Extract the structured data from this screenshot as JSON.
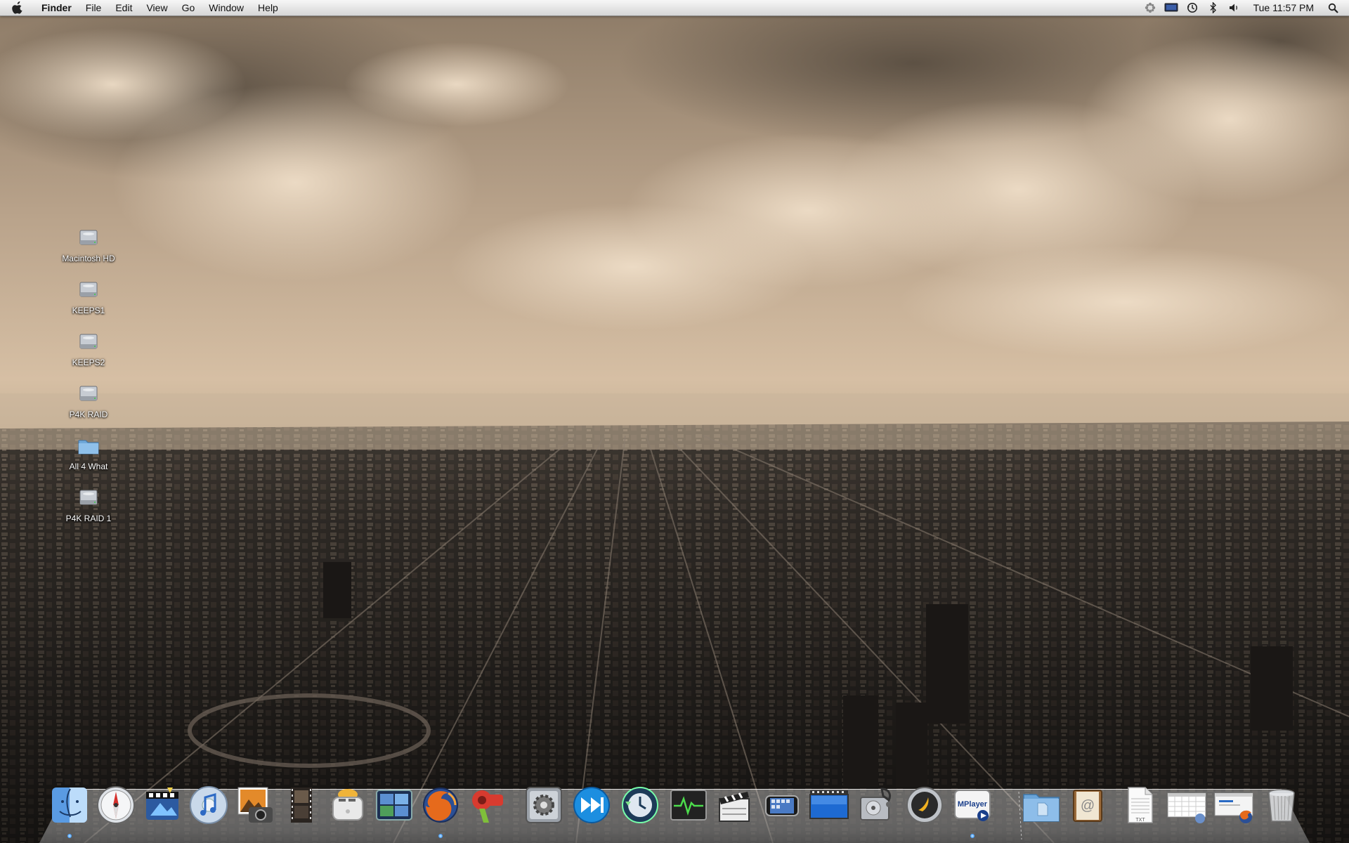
{
  "menubar": {
    "app_name": "Finder",
    "menus": [
      "File",
      "Edit",
      "View",
      "Go",
      "Window",
      "Help"
    ],
    "status_icons": [
      "flower-icon",
      "display-icon",
      "time-machine-icon",
      "bluetooth-icon",
      "volume-icon"
    ],
    "clock": "Tue 11:57 PM",
    "spotlight_icon": "magnifier-icon"
  },
  "desktop": {
    "icons": [
      {
        "label": "Macintosh HD",
        "kind": "drive"
      },
      {
        "label": "KEEPS1",
        "kind": "drive"
      },
      {
        "label": "KEEPS2",
        "kind": "drive"
      },
      {
        "label": "P4K RAID",
        "kind": "drive"
      },
      {
        "label": "All 4 What",
        "kind": "folder"
      },
      {
        "label": "P4K RAID 1",
        "kind": "drive"
      }
    ]
  },
  "dock": {
    "apps": [
      {
        "name": "finder-icon",
        "running": true
      },
      {
        "name": "safari-icon",
        "running": false
      },
      {
        "name": "imovie-icon",
        "running": false
      },
      {
        "name": "itunes-icon",
        "running": false
      },
      {
        "name": "iphoto-icon",
        "running": false
      },
      {
        "name": "film-strip-icon",
        "running": false
      },
      {
        "name": "toaster-icon",
        "running": false
      },
      {
        "name": "spaces-icon",
        "running": false
      },
      {
        "name": "firefox-icon",
        "running": true
      },
      {
        "name": "hair-dryer-icon",
        "running": false
      },
      {
        "name": "system-preferences-icon",
        "running": false
      },
      {
        "name": "fast-forward-icon",
        "running": false
      },
      {
        "name": "time-machine-icon",
        "running": false
      },
      {
        "name": "activity-monitor-icon",
        "running": false
      },
      {
        "name": "clapperboard-icon",
        "running": false
      },
      {
        "name": "iphone-icon",
        "running": false
      },
      {
        "name": "screen-display-icon",
        "running": false
      },
      {
        "name": "disk-utility-icon",
        "running": false
      },
      {
        "name": "slingbox-icon",
        "running": false
      },
      {
        "name": "mplayer-icon",
        "running": true
      }
    ],
    "mplayer_label": "MPlayer",
    "stacks": [
      {
        "name": "documents-folder-icon"
      },
      {
        "name": "address-book-icon"
      },
      {
        "name": "txt-file-icon",
        "label": "TXT"
      },
      {
        "name": "calendar-window-icon"
      },
      {
        "name": "firefox-window-icon"
      },
      {
        "name": "trash-icon"
      }
    ]
  }
}
